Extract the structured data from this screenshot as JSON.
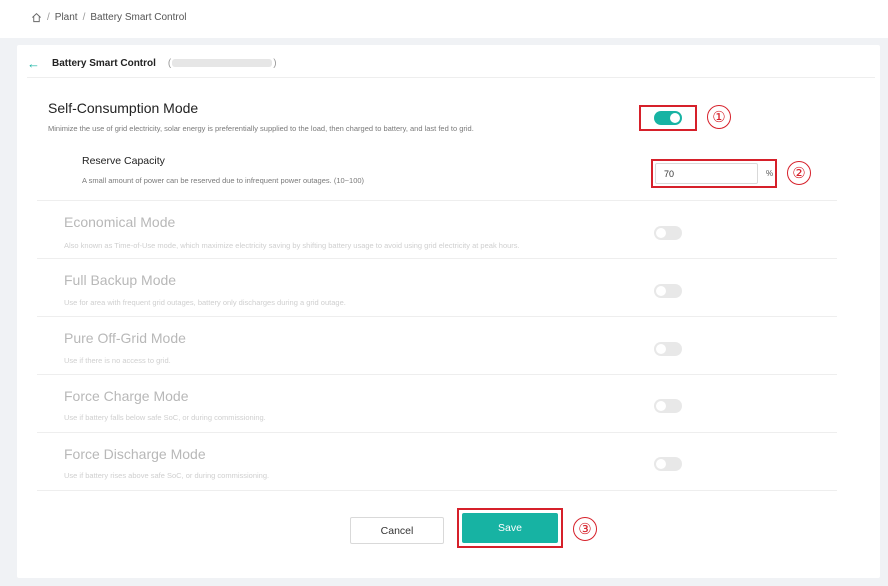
{
  "breadcrumb": {
    "home_icon": "home-icon",
    "sep": "/",
    "plant": "Plant",
    "current": "Battery Smart Control"
  },
  "header": {
    "title": "Battery Smart Control",
    "open_paren": "(",
    "close_paren": ")"
  },
  "self_consumption": {
    "title": "Self-Consumption Mode",
    "desc": "Minimize the use of grid electricity, solar energy is preferentially supplied to the load, then charged to battery, and last fed to grid.",
    "enabled": true,
    "callout": "①"
  },
  "reserve_capacity": {
    "title": "Reserve Capacity",
    "desc": "A small amount of power can be reserved due to infrequent power outages. (10~100)",
    "value": "70",
    "unit": "%",
    "callout": "②"
  },
  "modes": [
    {
      "title": "Economical Mode",
      "desc": "Also known as Time-of-Use mode, which maximize electricity saving by shifting battery usage to avoid using grid electricity at peak hours.",
      "enabled": false
    },
    {
      "title": "Full Backup Mode",
      "desc": "Use for area with frequent grid outages, battery only discharges during a grid outage.",
      "enabled": false
    },
    {
      "title": "Pure Off-Grid Mode",
      "desc": "Use if there is no access to grid.",
      "enabled": false
    },
    {
      "title": "Force Charge Mode",
      "desc": "Use if battery falls below safe SoC, or during commissioning.",
      "enabled": false
    },
    {
      "title": "Force Discharge Mode",
      "desc": "Use if battery rises above safe SoC, or during commissioning.",
      "enabled": false
    }
  ],
  "actions": {
    "cancel": "Cancel",
    "save": "Save",
    "save_callout": "③"
  },
  "colors": {
    "accent": "#17b3a3",
    "highlight": "#d6202a"
  }
}
